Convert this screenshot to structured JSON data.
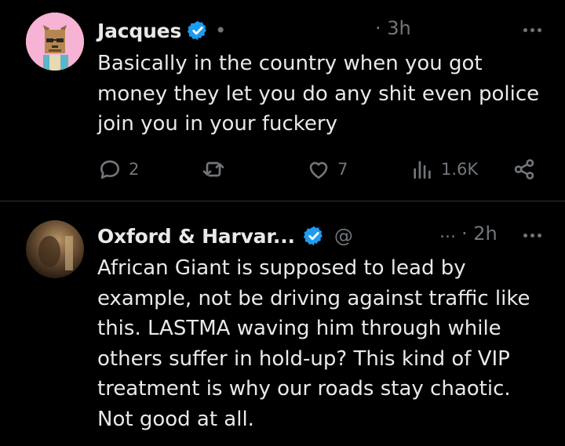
{
  "tweets": [
    {
      "name": "Jacques",
      "handle": "•",
      "time": "· 3h",
      "text": "Basically in the country when you got money they let you do any shit even police join you in your fuckery",
      "replies": "2",
      "reposts": "",
      "likes": "7",
      "views": "1.6K"
    },
    {
      "name": "Oxford & Harvar...",
      "handle": "@",
      "handle_tail": "...",
      "time": "· 2h",
      "text": "African Giant is supposed to lead by example, not be driving against traffic like this. LASTMA waving him through while others suffer in hold-up? This kind of VIP treatment is why our roads stay chaotic. Not good at all."
    }
  ],
  "colors": {
    "background": "#000000",
    "text": "#e7e9ea",
    "secondary": "#71767b",
    "verified": "#1d9bf0",
    "divider": "#2f3336"
  },
  "icons": [
    "verified-badge-icon",
    "reply-icon",
    "repost-icon",
    "like-icon",
    "views-icon",
    "share-icon",
    "more-icon"
  ]
}
